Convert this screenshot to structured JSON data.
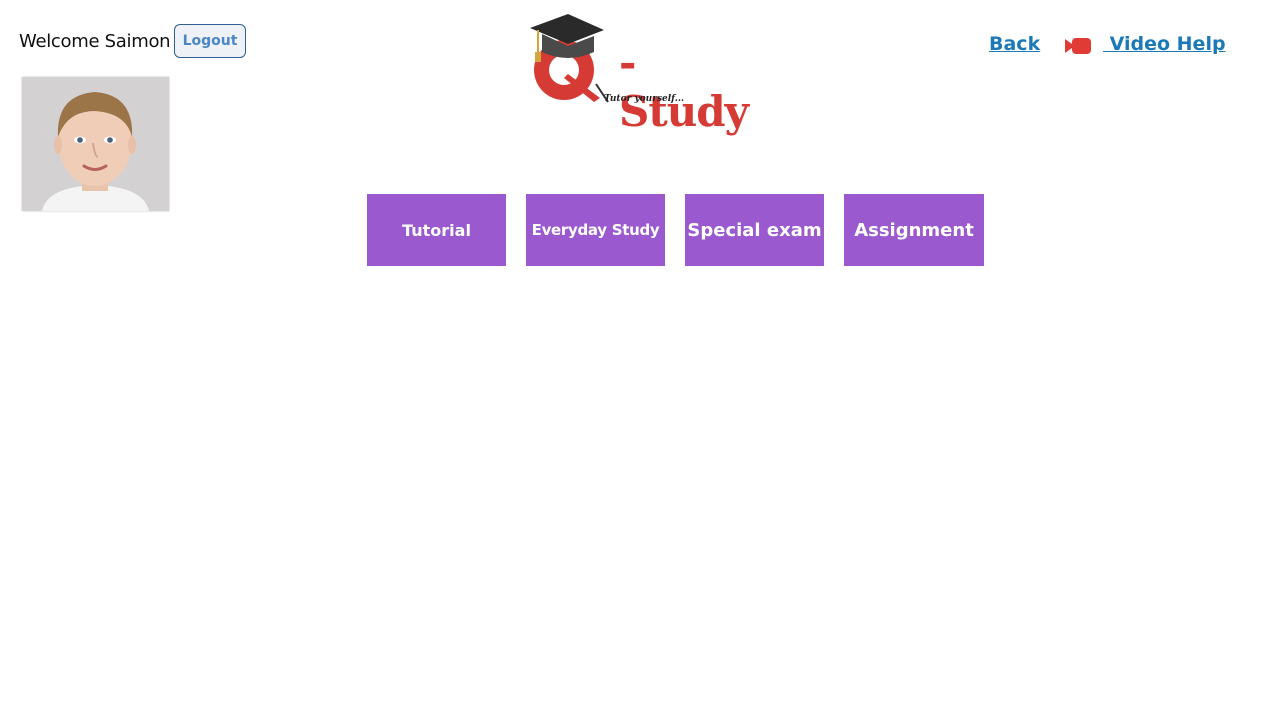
{
  "header": {
    "welcome_text": "Welcome Saimon",
    "logout_label": "Logout",
    "back_label": "Back",
    "video_help_label": " Video Help",
    "logo": {
      "name": "Q-Study",
      "main_text": "-Study",
      "tagline": "Tutor yourself..."
    }
  },
  "user": {
    "avatar_icon": "child-portrait"
  },
  "menu": {
    "items": [
      {
        "label": "Tutorial"
      },
      {
        "label": "Everyday Study"
      },
      {
        "label": "Special exam"
      },
      {
        "label": "Assignment"
      }
    ]
  },
  "colors": {
    "menu_button": "#9b59cf",
    "link": "#1b79b8",
    "logo_red": "#d63a34"
  }
}
